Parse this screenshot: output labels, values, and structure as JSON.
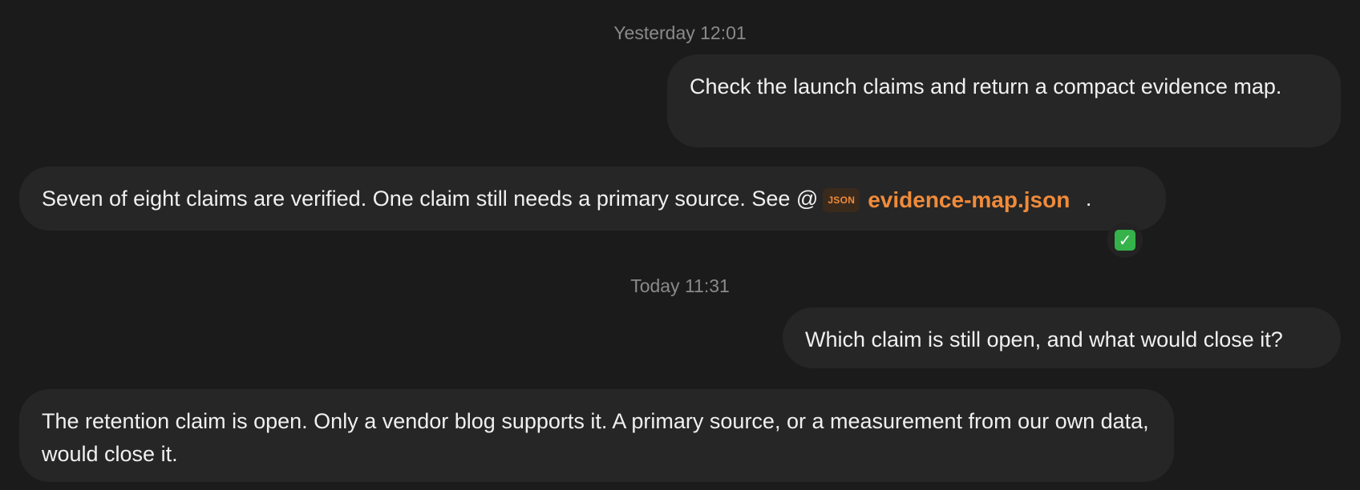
{
  "conversation": {
    "timestamps": [
      "Yesterday 12:01",
      "Today 11:31"
    ],
    "messages": [
      {
        "role": "user",
        "text": "Check the launch claims and return a compact evidence map."
      },
      {
        "role": "assistant",
        "text": "Seven of eight claims are verified. One claim still needs a primary source. See @",
        "attachment": {
          "badge": "JSON",
          "filename": "evidence-map.json",
          "after": "."
        },
        "reaction": {
          "icon": "green-check-icon",
          "glyph": "✓"
        }
      },
      {
        "role": "user",
        "text": "Which claim is still open, and what would close it?"
      },
      {
        "role": "assistant",
        "text": "The retention claim is open. Only a vendor blog supports it. A primary source, or a measurement from our own data, would close it."
      }
    ]
  },
  "colors": {
    "background": "#1b1b1b",
    "bubble": "#262626",
    "accent": "#f08b3a",
    "timestamp": "#8a8a8a",
    "check": "#35b34a"
  }
}
